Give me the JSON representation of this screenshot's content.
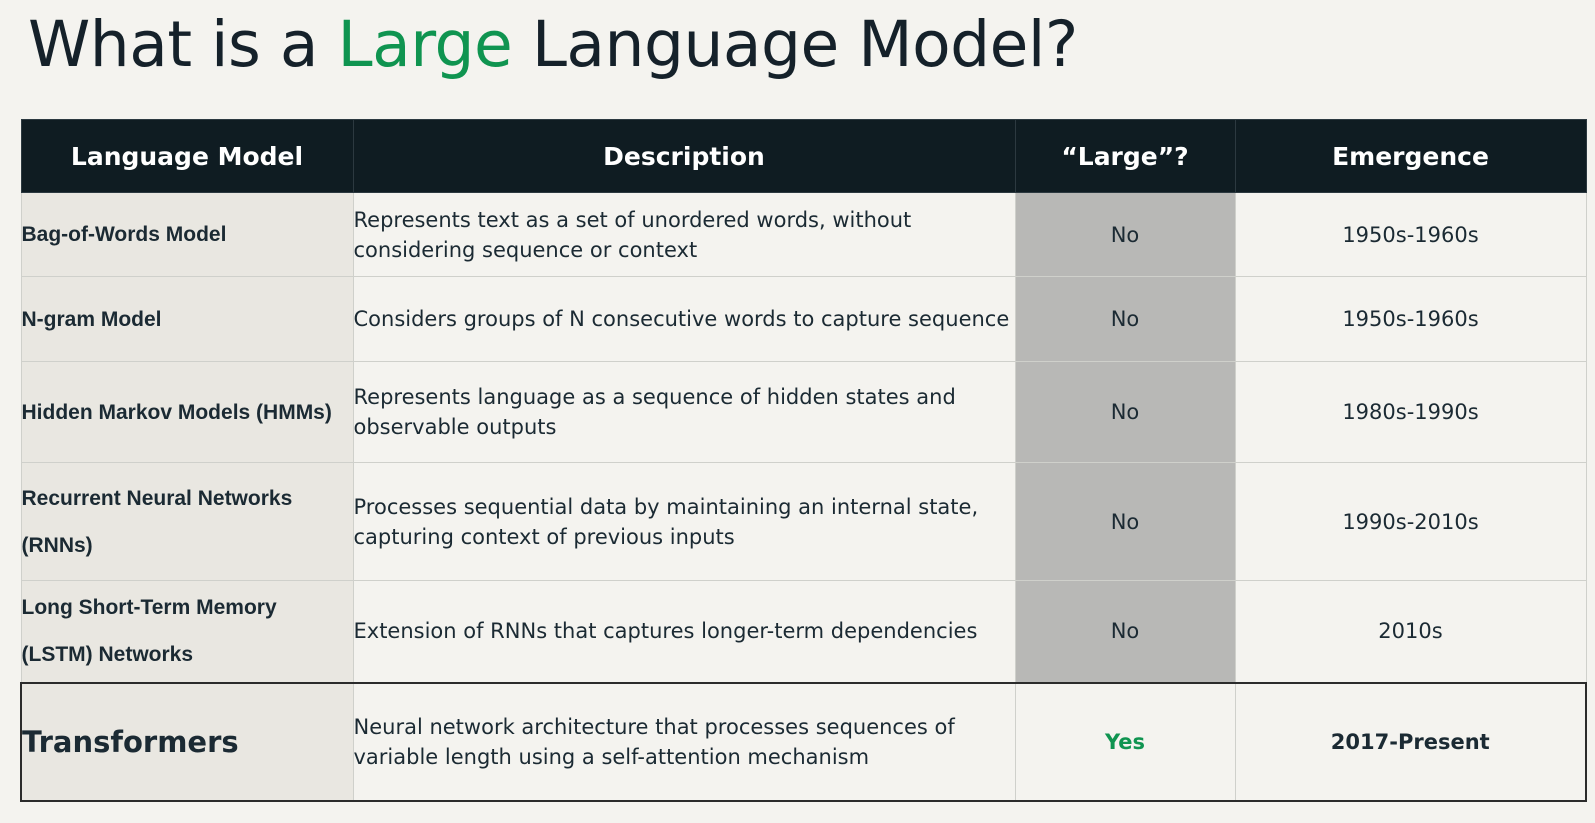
{
  "title": {
    "prefix": "What is a ",
    "highlight": "Large",
    "suffix": " Language Model?"
  },
  "colors": {
    "accent": "#0f9450",
    "header_bg": "#0f1c22",
    "shaded_cell": "#b8b8b6",
    "background": "#f4f3ef"
  },
  "table": {
    "headers": [
      "Language Model",
      "Description",
      "“Large”?",
      "Emergence"
    ],
    "rows": [
      {
        "model": "Bag-of-Words Model",
        "description": "Represents text as a set of unordered words, without considering sequence or context",
        "large": "No",
        "emergence": "1950s-1960s"
      },
      {
        "model": "N-gram Model",
        "description": "Considers groups of N consecutive words to capture sequence",
        "large": "No",
        "emergence": "1950s-1960s"
      },
      {
        "model": "Hidden Markov Models (HMMs)",
        "description": "Represents language as a sequence of hidden states and observable outputs",
        "large": "No",
        "emergence": "1980s-1990s"
      },
      {
        "model": "Recurrent Neural Networks (RNNs)",
        "description": "Processes sequential data by maintaining an internal state, capturing context of previous inputs",
        "large": "No",
        "emergence": "1990s-2010s"
      },
      {
        "model": "Long Short-Term Memory (LSTM) Networks",
        "description": "Extension of RNNs that captures longer-term dependencies",
        "large": "No",
        "emergence": "2010s"
      },
      {
        "model": "Transformers",
        "description": "Neural network architecture that processes sequences of variable length using a self-attention mechanism",
        "large": "Yes",
        "emergence": "2017-Present"
      }
    ]
  }
}
